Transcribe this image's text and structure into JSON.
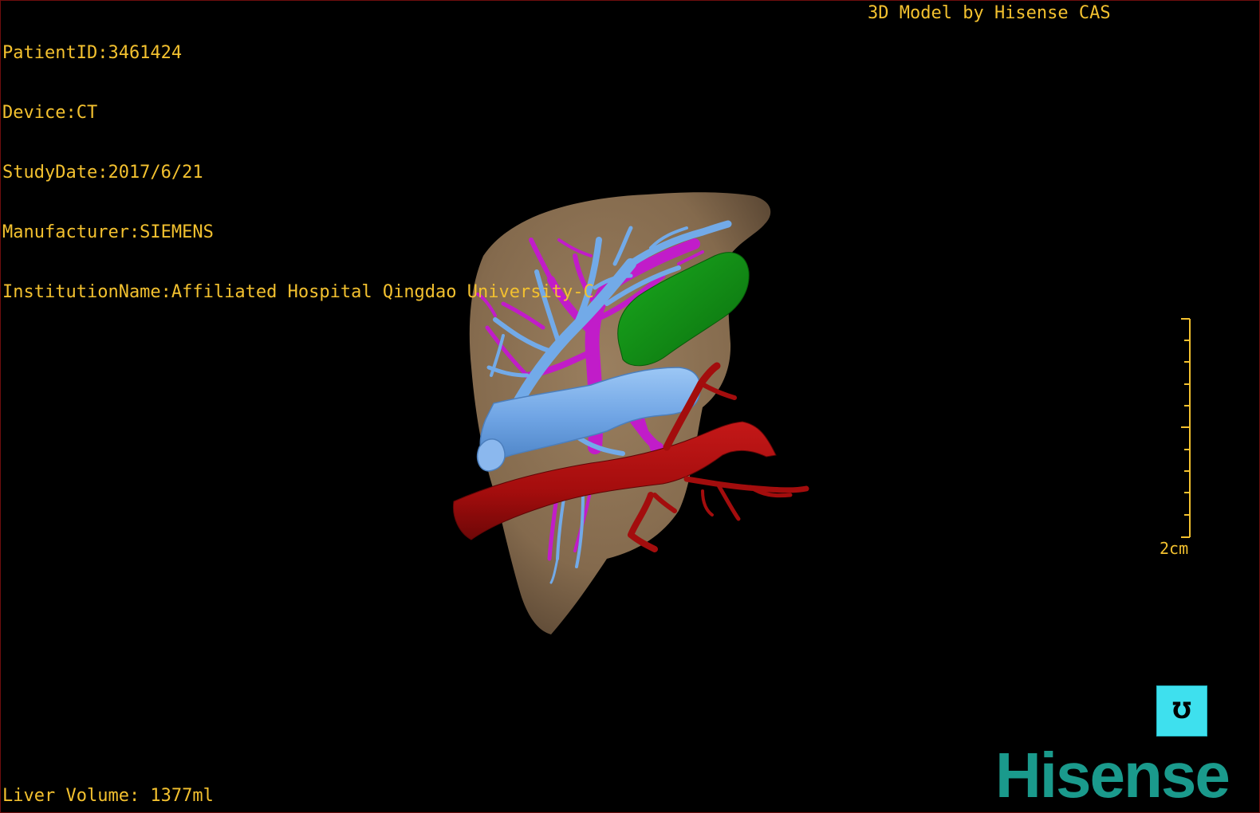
{
  "patient_info": {
    "patient_id": "PatientID:3461424",
    "device": "Device:CT",
    "study_date": "StudyDate:2017/6/21",
    "manufacturer": "Manufacturer:SIEMENS",
    "institution": "InstitutionName:Affiliated Hospital Qingdao University-C"
  },
  "caption": "3D Model by Hisense CAS",
  "volume": "Liver Volume: 1377ml",
  "scale": {
    "label": "2cm"
  },
  "orientation_cube": {
    "face_glyph": "℧",
    "icon": "orientation-cube-icon"
  },
  "logo": {
    "text": "Hisense",
    "color": "#1a9a8c"
  },
  "colors": {
    "overlay_text": "#f3c12f",
    "liver": "#8c7355",
    "portal_vein": "#6fa9e6",
    "hepatic_vein": "#c11cc9",
    "gallbladder": "#119415",
    "artery": "#a90e0e",
    "orientation_cube": "#3ee0ee"
  }
}
